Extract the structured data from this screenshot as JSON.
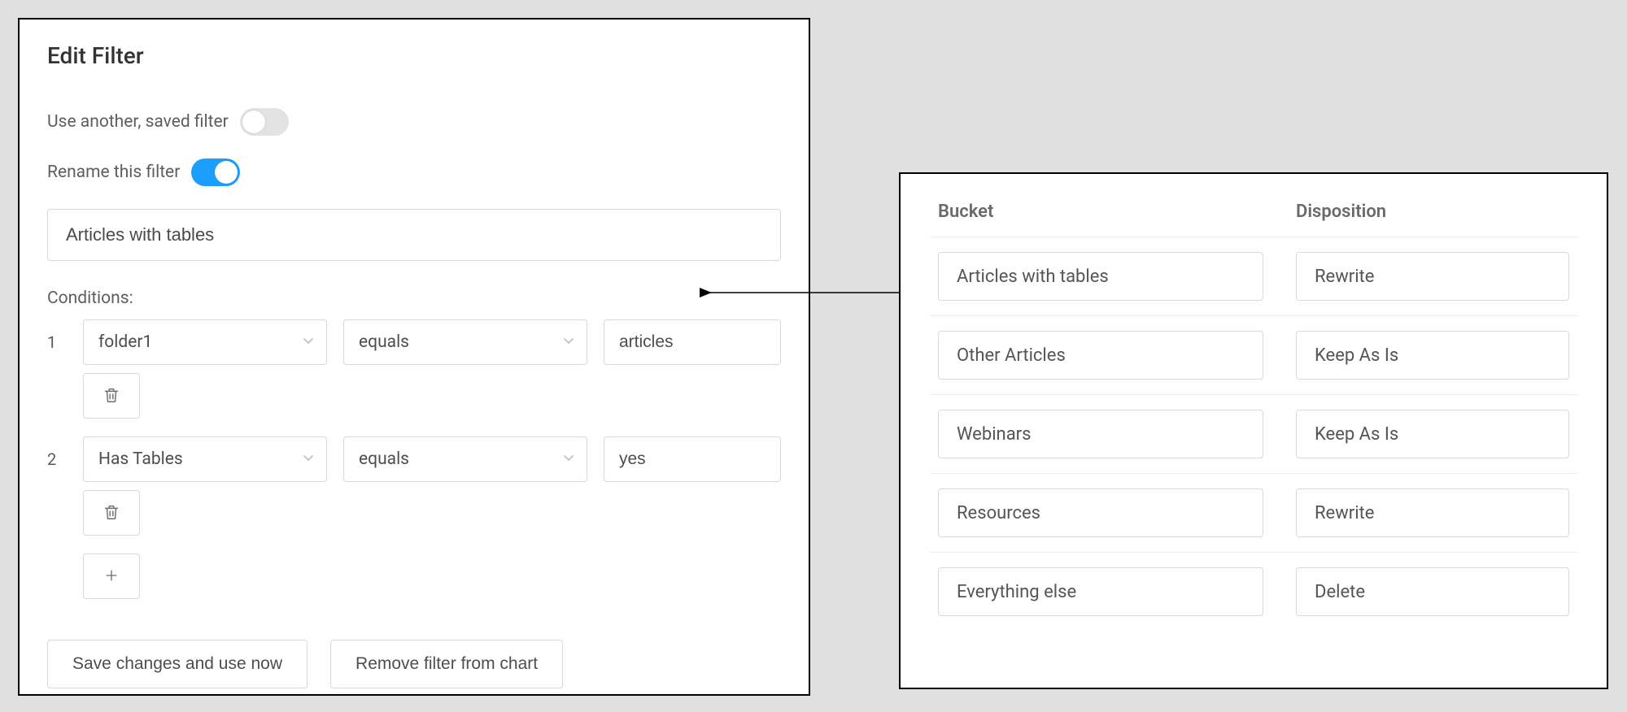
{
  "editFilter": {
    "title": "Edit Filter",
    "useSavedFilterLabel": "Use another, saved filter",
    "useSavedFilterOn": false,
    "renameFilterLabel": "Rename this filter",
    "renameFilterOn": true,
    "filterName": "Articles with tables",
    "conditionsLabel": "Conditions:",
    "conditions": [
      {
        "index": "1",
        "field": "folder1",
        "operator": "equals",
        "value": "articles"
      },
      {
        "index": "2",
        "field": "Has Tables",
        "operator": "equals",
        "value": "yes"
      }
    ],
    "saveLabel": "Save changes and use now",
    "removeLabel": "Remove filter from chart"
  },
  "mappingTable": {
    "headers": {
      "bucket": "Bucket",
      "disposition": "Disposition"
    },
    "rows": [
      {
        "bucket": "Articles with tables",
        "disposition": "Rewrite"
      },
      {
        "bucket": "Other Articles",
        "disposition": "Keep As Is"
      },
      {
        "bucket": "Webinars",
        "disposition": "Keep As Is"
      },
      {
        "bucket": "Resources",
        "disposition": "Rewrite"
      },
      {
        "bucket": "Everything else",
        "disposition": "Delete"
      }
    ]
  }
}
